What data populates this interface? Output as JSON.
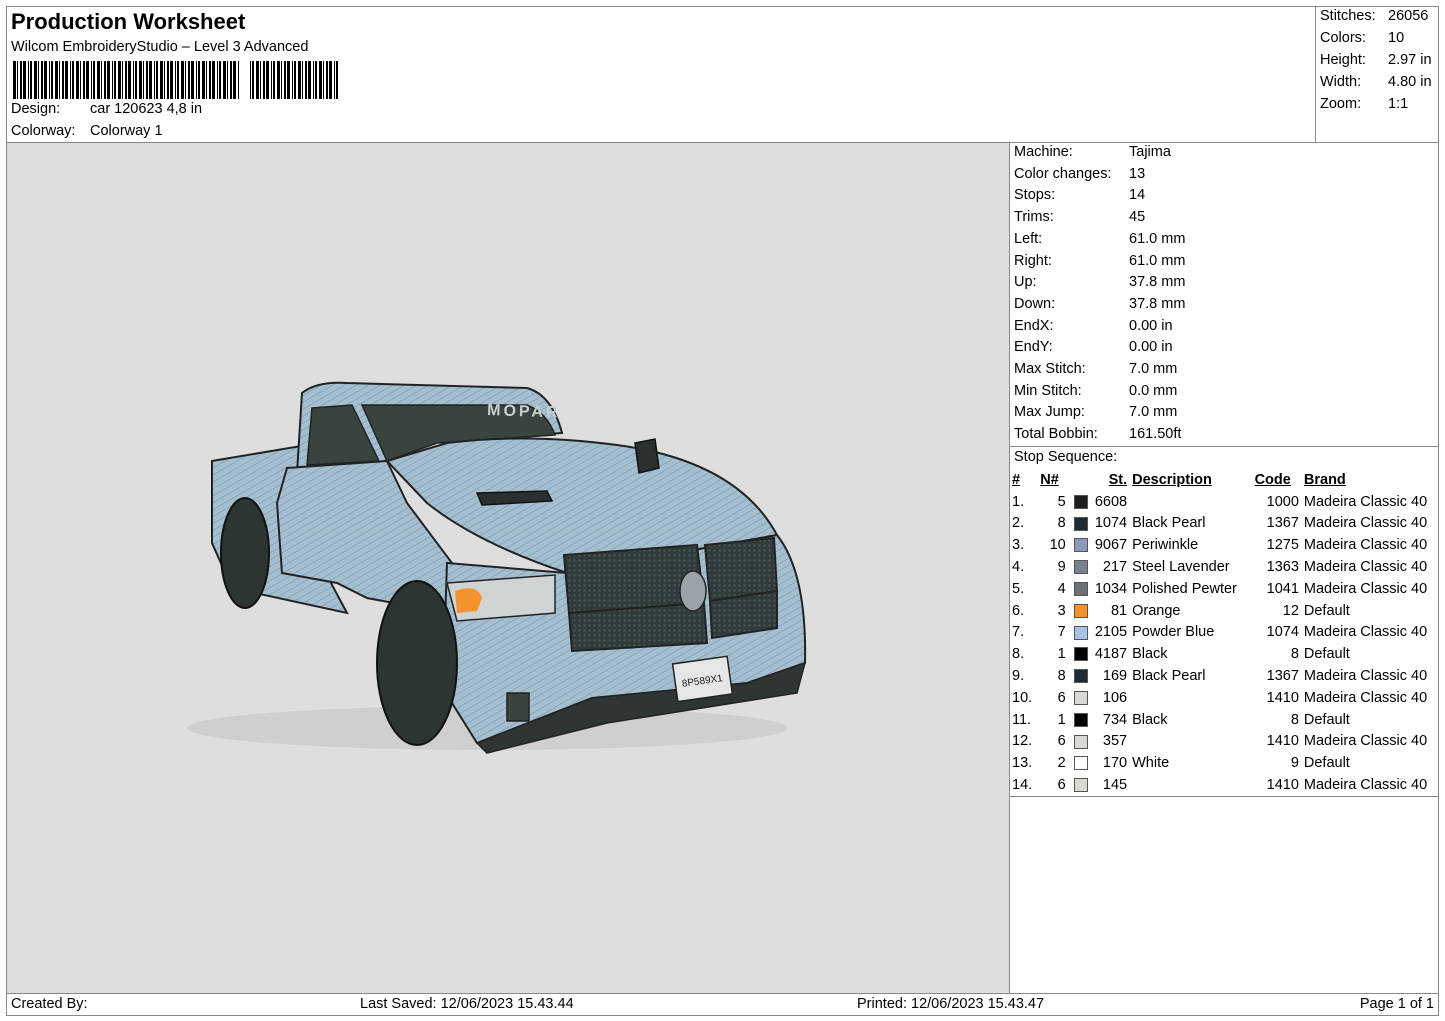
{
  "header": {
    "title": "Production Worksheet",
    "subtitle": "Wilcom EmbroideryStudio – Level 3 Advanced",
    "design_label": "Design:",
    "design_value": "car 120623 4,8 in",
    "colorway_label": "Colorway:",
    "colorway_value": "Colorway 1"
  },
  "stats": [
    {
      "label": "Stitches:",
      "value": "26056"
    },
    {
      "label": "Colors:",
      "value": "10"
    },
    {
      "label": "Height:",
      "value": "2.97 in"
    },
    {
      "label": "Width:",
      "value": "4.80 in"
    },
    {
      "label": "Zoom:",
      "value": "1:1"
    }
  ],
  "preview": {
    "windshield_text": "MOPAR",
    "plate_text": "8P589X1"
  },
  "machine_info": [
    {
      "label": "Machine:",
      "value": "Tajima"
    },
    {
      "label": "Color changes:",
      "value": "13"
    },
    {
      "label": "Stops:",
      "value": "14"
    },
    {
      "label": "Trims:",
      "value": "45"
    },
    {
      "label": "Left:",
      "value": "61.0 mm"
    },
    {
      "label": "Right:",
      "value": "61.0 mm"
    },
    {
      "label": "Up:",
      "value": "37.8 mm"
    },
    {
      "label": "Down:",
      "value": "37.8 mm"
    },
    {
      "label": "EndX:",
      "value": "0.00 in"
    },
    {
      "label": "EndY:",
      "value": "0.00 in"
    },
    {
      "label": "Max Stitch:",
      "value": "7.0 mm"
    },
    {
      "label": "Min Stitch:",
      "value": "0.0 mm"
    },
    {
      "label": "Max Jump:",
      "value": "7.0 mm"
    },
    {
      "label": "Total Bobbin:",
      "value": "161.50ft"
    }
  ],
  "stop_sequence": {
    "title": "Stop Sequence:",
    "headers": {
      "idx": "#",
      "n": "N#",
      "st": "St.",
      "desc": "Description",
      "code": "Code",
      "brand": "Brand"
    },
    "rows": [
      {
        "idx": "1.",
        "n": "5",
        "color": "#1a1c1e",
        "st": "6608",
        "desc": "",
        "code": "1000",
        "brand": "Madeira Classic 40"
      },
      {
        "idx": "2.",
        "n": "8",
        "color": "#1f2a33",
        "st": "1074",
        "desc": "Black Pearl",
        "code": "1367",
        "brand": "Madeira Classic 40"
      },
      {
        "idx": "3.",
        "n": "10",
        "color": "#8b9ab9",
        "st": "9067",
        "desc": "Periwinkle",
        "code": "1275",
        "brand": "Madeira Classic 40"
      },
      {
        "idx": "4.",
        "n": "9",
        "color": "#76828f",
        "st": "217",
        "desc": "Steel Lavender",
        "code": "1363",
        "brand": "Madeira Classic 40"
      },
      {
        "idx": "5.",
        "n": "4",
        "color": "#6d7173",
        "st": "1034",
        "desc": "Polished Pewter",
        "code": "1041",
        "brand": "Madeira Classic 40"
      },
      {
        "idx": "6.",
        "n": "3",
        "color": "#f2932b",
        "st": "81",
        "desc": "Orange",
        "code": "12",
        "brand": "Default"
      },
      {
        "idx": "7.",
        "n": "7",
        "color": "#a9c2e6",
        "st": "2105",
        "desc": "Powder Blue",
        "code": "1074",
        "brand": "Madeira Classic 40"
      },
      {
        "idx": "8.",
        "n": "1",
        "color": "#000000",
        "st": "4187",
        "desc": "Black",
        "code": "8",
        "brand": "Default"
      },
      {
        "idx": "9.",
        "n": "8",
        "color": "#1f2a33",
        "st": "169",
        "desc": "Black Pearl",
        "code": "1367",
        "brand": "Madeira Classic 40"
      },
      {
        "idx": "10.",
        "n": "6",
        "color": "#d9d9d6",
        "st": "106",
        "desc": "",
        "code": "1410",
        "brand": "Madeira Classic 40"
      },
      {
        "idx": "11.",
        "n": "1",
        "color": "#000000",
        "st": "734",
        "desc": "Black",
        "code": "8",
        "brand": "Default"
      },
      {
        "idx": "12.",
        "n": "6",
        "color": "#d9d9d6",
        "st": "357",
        "desc": "",
        "code": "1410",
        "brand": "Madeira Classic 40"
      },
      {
        "idx": "13.",
        "n": "2",
        "color": "#ffffff",
        "st": "170",
        "desc": "White",
        "code": "9",
        "brand": "Default"
      },
      {
        "idx": "14.",
        "n": "6",
        "color": "#d9d9d6",
        "st": "145",
        "desc": "",
        "code": "1410",
        "brand": "Madeira Classic 40"
      }
    ]
  },
  "footer": {
    "created_by": "Created By:",
    "last_saved": "Last Saved: 12/06/2023 15.43.44",
    "printed": "Printed: 12/06/2023 15.43.47",
    "page": "Page 1 of 1"
  }
}
